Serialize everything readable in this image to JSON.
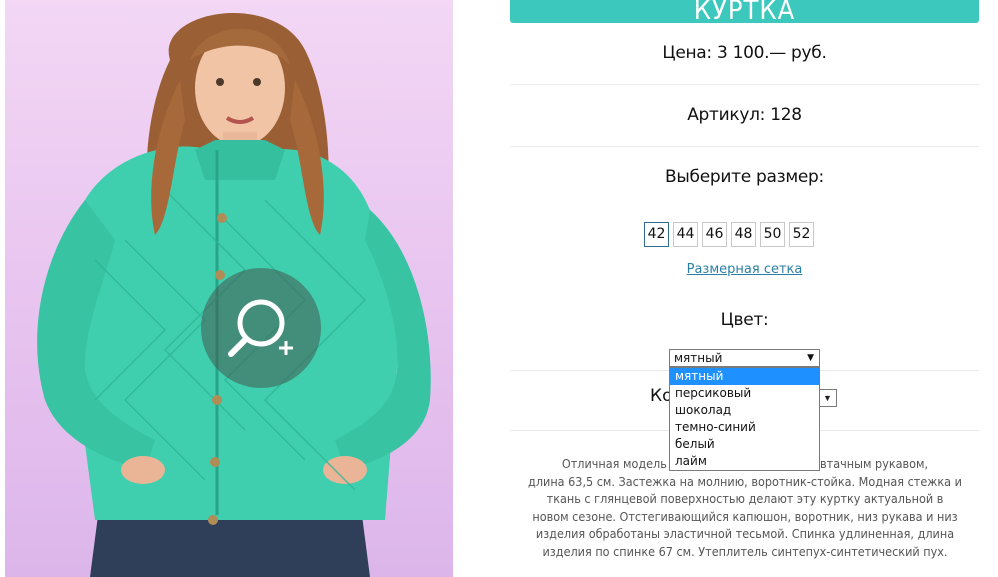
{
  "product": {
    "title": "КУРТКА",
    "price": "Цена: 3 100.— руб.",
    "article": "Артикул: 128"
  },
  "size": {
    "label": "Выберите размер:",
    "options": [
      "42",
      "44",
      "46",
      "48",
      "50",
      "52"
    ],
    "selected": "42",
    "chart_link": "Размерная сетка"
  },
  "color": {
    "label": "Цвет:",
    "selected": "мятный",
    "options": [
      "мятный",
      "персиковый",
      "шоколад",
      "темно-синий",
      "белый",
      "лайм"
    ],
    "highlighted": "мятный"
  },
  "quantity": {
    "label_visible": "Ко"
  },
  "description": "Отличная модель куртк... тка с втачным рукавом, длина 63,5 см. Застежка на молнию, воротник-стойка. Модная стежка и ткань с глянцевой поверхностью делают эту куртку актуальной в новом сезоне. Отстегивающийся капюшон, воротник, низ рукава и низ изделия обработаны эластичной тесьмой. Спинка удлиненная, длина изделия по спинке 67 см. Утеплитель синтепух-синтетический пух.",
  "description_lines": [
    "Отличная модель куртк                       тка с втачным рукавом,",
    "длина 63,5 см. Застежка на молнию, воротник-стойка. Модная стежка и",
    "ткань с глянцевой поверхностью делают эту куртку актуальной в",
    "новом сезоне. Отстегивающийся капюшон, воротник, низ рукава и низ",
    "изделия обработаны эластичной тесьмой. Спинка удлиненная, длина",
    "изделия по спинке 67 см. Утеплитель синтепух-синтетический пух."
  ],
  "colors": {
    "accent": "#3cc8bd",
    "jacket": "#3fcfae",
    "link": "#2a7fa6",
    "highlight": "#1e90ff"
  },
  "icons": {
    "zoom": "zoom-in-icon"
  }
}
